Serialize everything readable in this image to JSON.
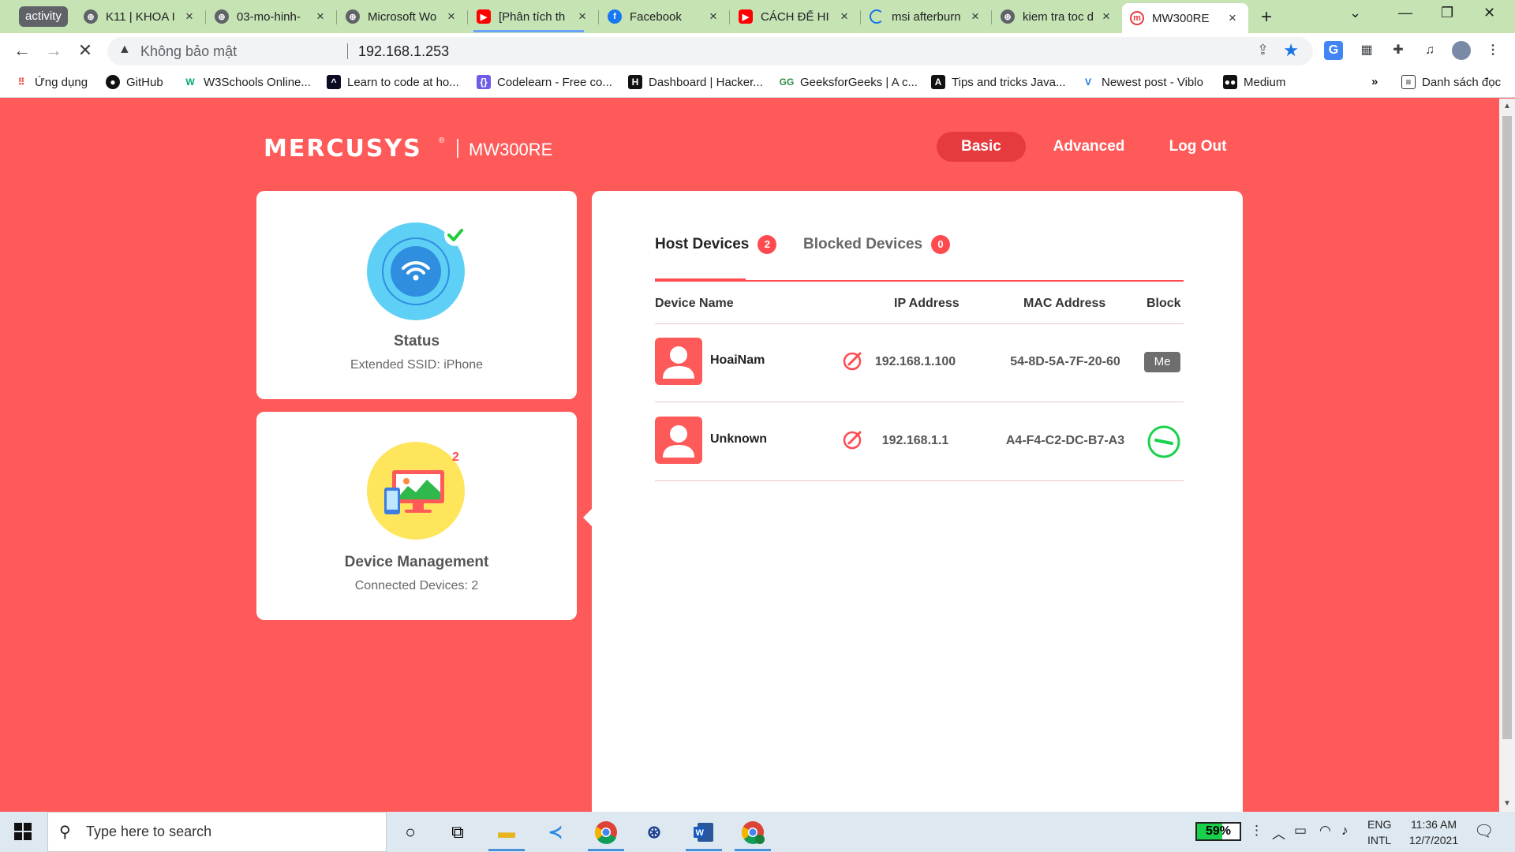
{
  "browser": {
    "tab_group_label": "activity",
    "tabs": [
      {
        "title": "K11 | KHOA I",
        "icon": "globe-icon",
        "color": "#5f6368"
      },
      {
        "title": "03-mo-hinh-",
        "icon": "globe-icon",
        "color": "#5f6368"
      },
      {
        "title": "Microsoft Wo",
        "icon": "globe-icon",
        "color": "#5f6368"
      },
      {
        "title": "[Phân tích th",
        "icon": "youtube-icon",
        "color": "#ff0000"
      },
      {
        "title": "Facebook",
        "icon": "facebook-icon",
        "color": "#1877f2"
      },
      {
        "title": "CÁCH ĐỂ HI",
        "icon": "youtube-icon",
        "color": "#ff0000"
      },
      {
        "title": "msi afterburn",
        "icon": "loading-spinner-icon",
        "color": "#1a73e8"
      },
      {
        "title": "kiem tra toc d",
        "icon": "globe-icon",
        "color": "#5f6368"
      },
      {
        "title": "MW300RE",
        "icon": "mercusys-icon",
        "color": "#e63a3f"
      }
    ],
    "address": {
      "security_label": "Không bảo mật",
      "url": "192.168.1.253"
    },
    "bookmarks": [
      {
        "label": "Ứng dụng",
        "icon": "apps-grid-icon"
      },
      {
        "label": "GitHub",
        "icon": "github-icon"
      },
      {
        "label": "W3Schools Online...",
        "icon": "w3schools-icon"
      },
      {
        "label": "Learn to code at ho...",
        "icon": "freecodecamp-icon"
      },
      {
        "label": "Codelearn - Free co...",
        "icon": "codelearn-icon"
      },
      {
        "label": "Dashboard | Hacker...",
        "icon": "hackerrank-icon"
      },
      {
        "label": "GeeksforGeeks | A c...",
        "icon": "geeksforgeeks-icon"
      },
      {
        "label": "Tips and tricks Java...",
        "icon": "a-letter-icon"
      },
      {
        "label": "Newest post - Viblo",
        "icon": "viblo-icon"
      },
      {
        "label": "Medium",
        "icon": "medium-icon"
      }
    ],
    "bookmarks_overflow": "»",
    "reading_list": "Danh sách đọc"
  },
  "router": {
    "brand": "MERCUSYS",
    "brand_mark": "®",
    "model": "MW300RE",
    "nav": {
      "basic": "Basic",
      "advanced": "Advanced",
      "logout": "Log Out"
    },
    "status_card": {
      "title": "Status",
      "subtitle": "Extended SSID: iPhone"
    },
    "device_card": {
      "title": "Device Management",
      "subtitle": "Connected Devices: 2",
      "count_badge": "2"
    },
    "tabs": {
      "host": "Host Devices",
      "host_count": "2",
      "blocked": "Blocked Devices",
      "blocked_count": "0"
    },
    "table": {
      "headers": {
        "name": "Device Name",
        "ip": "IP Address",
        "mac": "MAC Address",
        "block": "Block"
      },
      "rows": [
        {
          "name": "HoaiNam",
          "ip": "192.168.1.100",
          "mac": "54-8D-5A-7F-20-60",
          "block": "Me"
        },
        {
          "name": "Unknown",
          "ip": "192.168.1.1",
          "mac": "A4-F4-C2-DC-B7-A3",
          "block": "block-toggle"
        }
      ]
    }
  },
  "taskbar": {
    "search_placeholder": "Type here to search",
    "battery": "59%",
    "battery_level": 0.59,
    "lang_top": "ENG",
    "lang_bottom": "INTL",
    "time": "11:36 AM",
    "date": "12/7/2021"
  },
  "colors": {
    "page_bg": "#ff5a5a",
    "accent": "#ff4b50",
    "active_nav": "#e63a3f",
    "tabbar_bg": "#c6e3b4",
    "ok_green": "#19d24c"
  }
}
